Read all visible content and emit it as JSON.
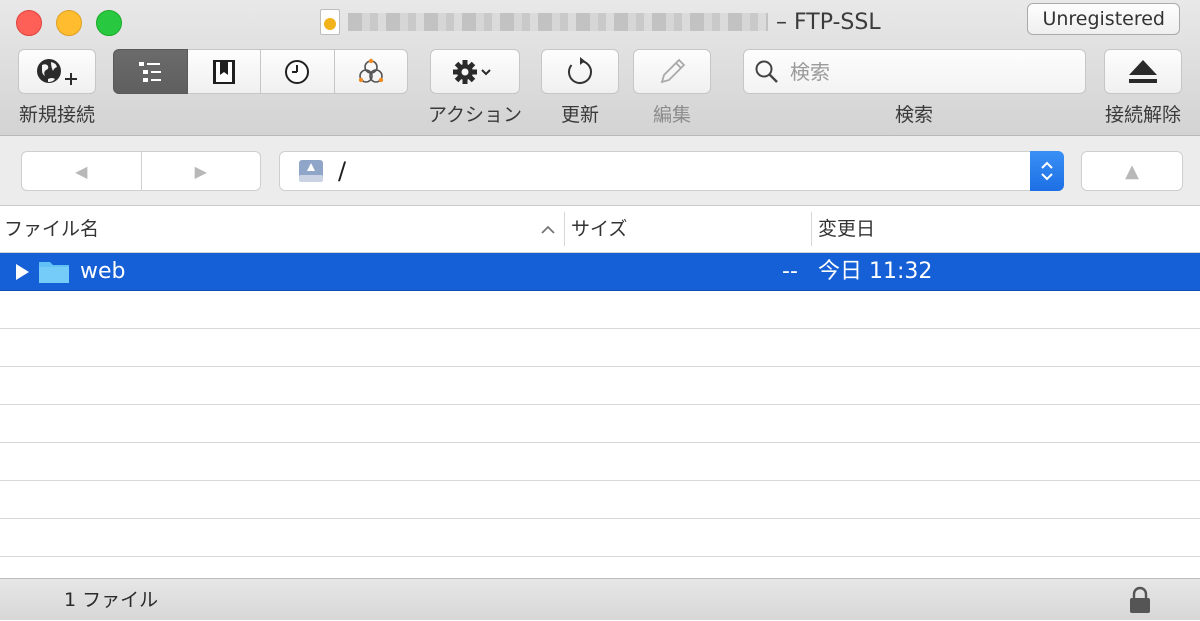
{
  "window": {
    "title": "– FTP-SSL",
    "unregistered_label": "Unregistered"
  },
  "toolbar": {
    "new_connection_label": "新規接続",
    "action_label": "アクション",
    "refresh_label": "更新",
    "edit_label": "編集",
    "search_label": "検索",
    "search_placeholder": "検索",
    "disconnect_label": "接続解除",
    "view_modes": [
      "browser",
      "bookmarks",
      "history",
      "bonjour"
    ]
  },
  "navigation": {
    "back_glyph": "◀",
    "forward_glyph": "▶",
    "path": "/",
    "up_glyph": "▲"
  },
  "table": {
    "columns": [
      "ファイル名",
      "サイズ",
      "変更日"
    ],
    "rows": [
      {
        "name": "web",
        "size": "--",
        "modified": "今日 11:32",
        "selected": true
      }
    ]
  },
  "status": {
    "count_text": "1 ファイル"
  },
  "colors": {
    "selection": "#1560d6",
    "folder": "#62c1f7",
    "stepper": "#2a7ff0"
  }
}
